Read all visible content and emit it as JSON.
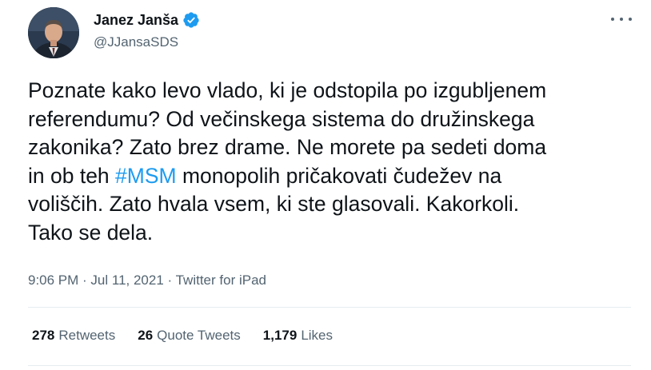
{
  "author": {
    "display_name": "Janez Janša",
    "handle": "@JJansaSDS",
    "verified": true,
    "verified_icon": "verified-badge-icon",
    "verified_color": "#1d9bf0"
  },
  "tweet": {
    "lines": [
      [
        "Poznate kako levo vlado, ki je odstopila po izgubljenem"
      ],
      [
        "referendumu? Od večinskega sistema do družinskega"
      ],
      [
        "zakonika? Zato brez drame. Ne morete pa sedeti doma"
      ],
      [
        "in ob teh ",
        "#MSM",
        " monopolih pričakovati čudežev na"
      ],
      [
        "voliščih. Zato hvala vsem, ki ste glasovali. Kakorkoli."
      ],
      [
        "Tako se dela."
      ]
    ],
    "hashtag": "#MSM",
    "hashtag_color": "#1d9bf0"
  },
  "meta": {
    "time": "9:06 PM",
    "separator": " · ",
    "date": "Jul 11, 2021",
    "source": "Twitter for iPad"
  },
  "stats": {
    "retweets_count": "278",
    "retweets_label": "Retweets",
    "quotes_count": "26",
    "quotes_label": "Quote Tweets",
    "likes_count": "1,179",
    "likes_label": "Likes"
  },
  "more_icon": "more-horizontal-icon"
}
